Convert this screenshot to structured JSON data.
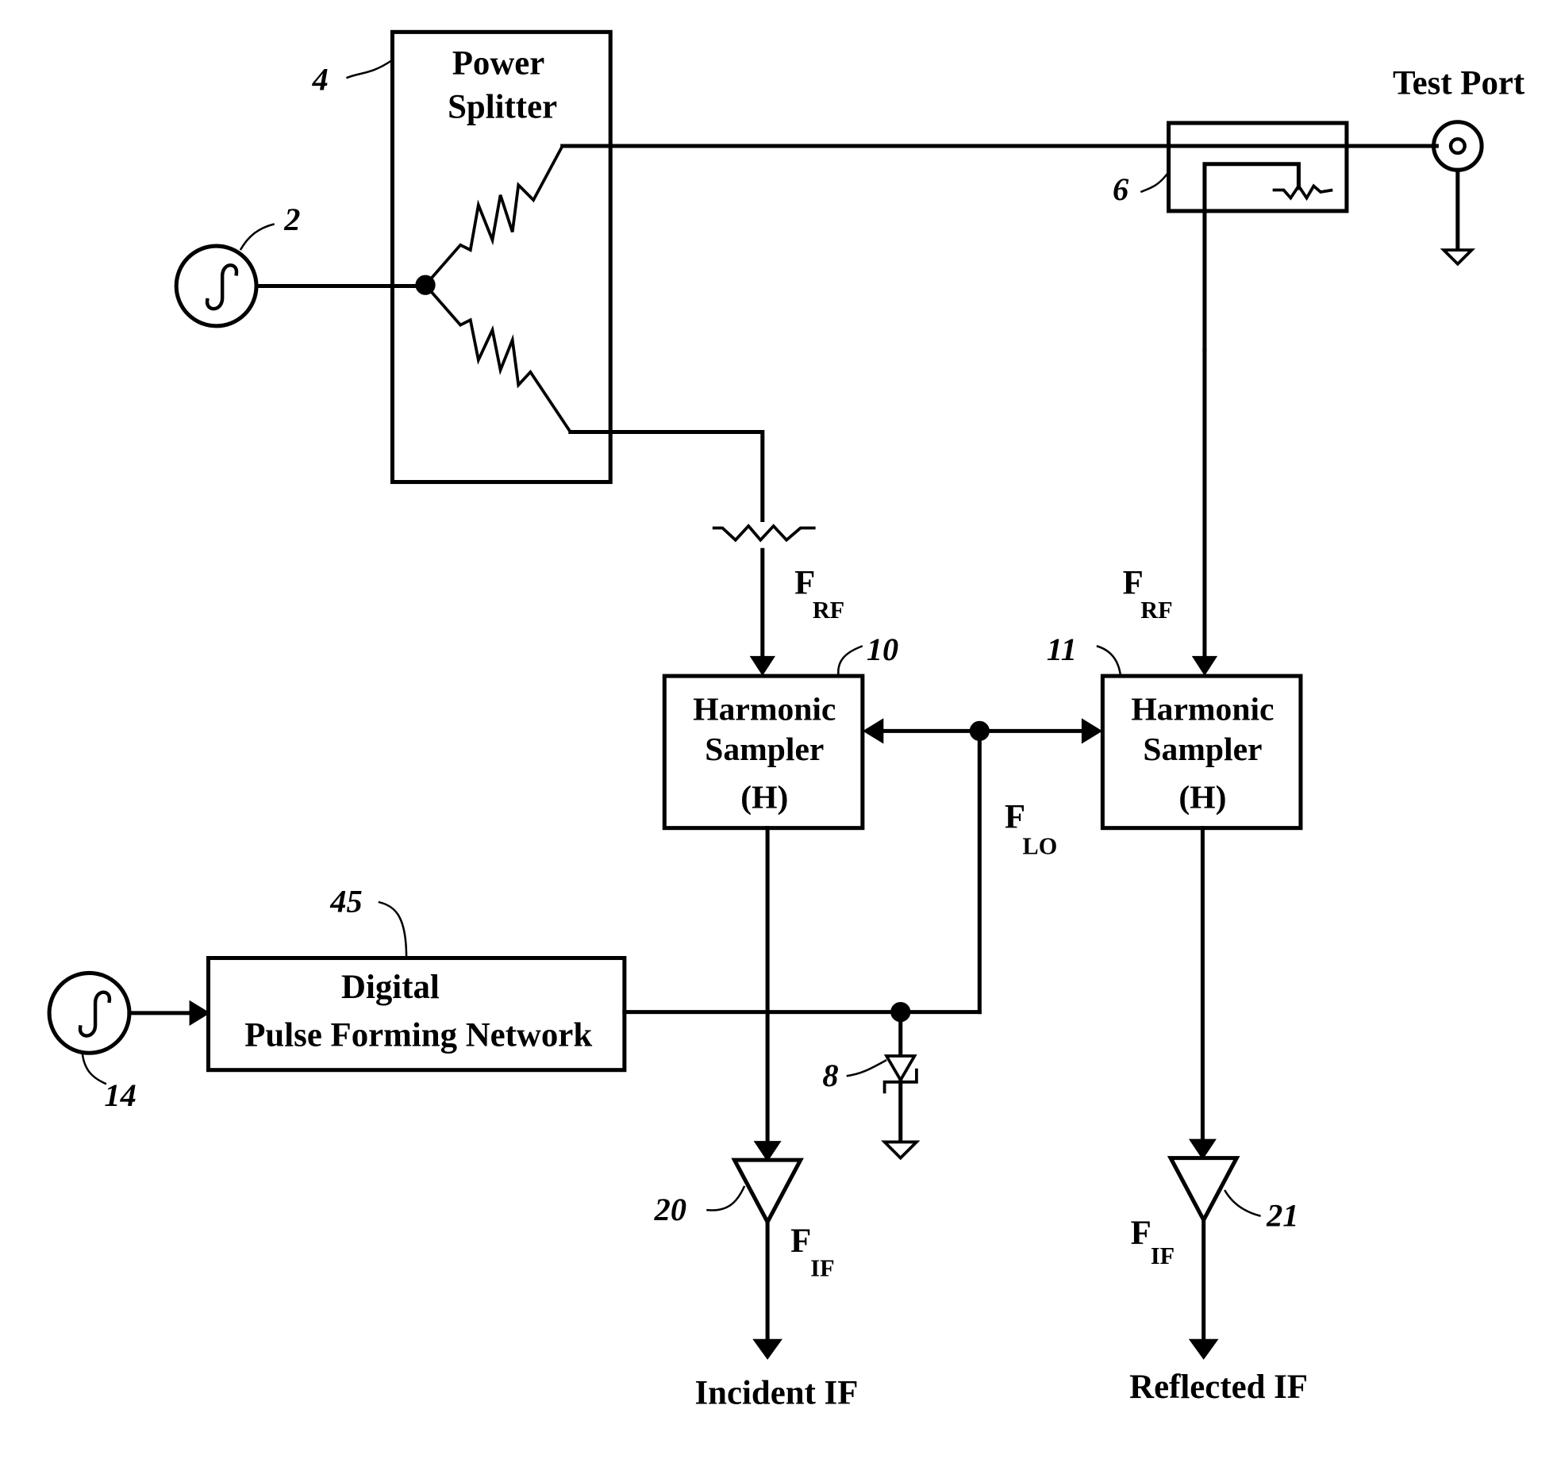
{
  "diagram": {
    "type": "block-diagram",
    "title": "",
    "blocks": {
      "power_splitter": {
        "line1": "Power",
        "line2": "Splitter",
        "ref": "4"
      },
      "harmonic_sampler_incident": {
        "line1": "Harmonic",
        "line2": "Sampler",
        "line3": "(H)",
        "ref": "10"
      },
      "harmonic_sampler_reflected": {
        "line1": "Harmonic",
        "line2": "Sampler",
        "line3": "(H)",
        "ref": "11"
      },
      "pulse_network": {
        "line1": "Digital",
        "line2": "Pulse Forming Network",
        "ref": "45"
      }
    },
    "components": {
      "rf_source": {
        "ref": "2",
        "icon": "sine-source-icon"
      },
      "lo_source": {
        "ref": "14",
        "icon": "sine-source-icon"
      },
      "directional_coupler": {
        "ref": "6"
      },
      "diode": {
        "ref": "8"
      },
      "amp_incident": {
        "ref": "20"
      },
      "amp_reflected": {
        "ref": "21"
      },
      "test_port": {
        "label": "Test Port",
        "icon": "coaxial-port-icon"
      }
    },
    "signals": {
      "frf_left": {
        "main": "F",
        "sub": "RF"
      },
      "frf_right": {
        "main": "F",
        "sub": "RF"
      },
      "flo": {
        "main": "F",
        "sub": "LO"
      },
      "fif_left": {
        "main": "F",
        "sub": "IF"
      },
      "fif_right": {
        "main": "F",
        "sub": "IF"
      }
    },
    "outputs": {
      "incident": "Incident IF",
      "reflected": "Reflected IF"
    }
  }
}
